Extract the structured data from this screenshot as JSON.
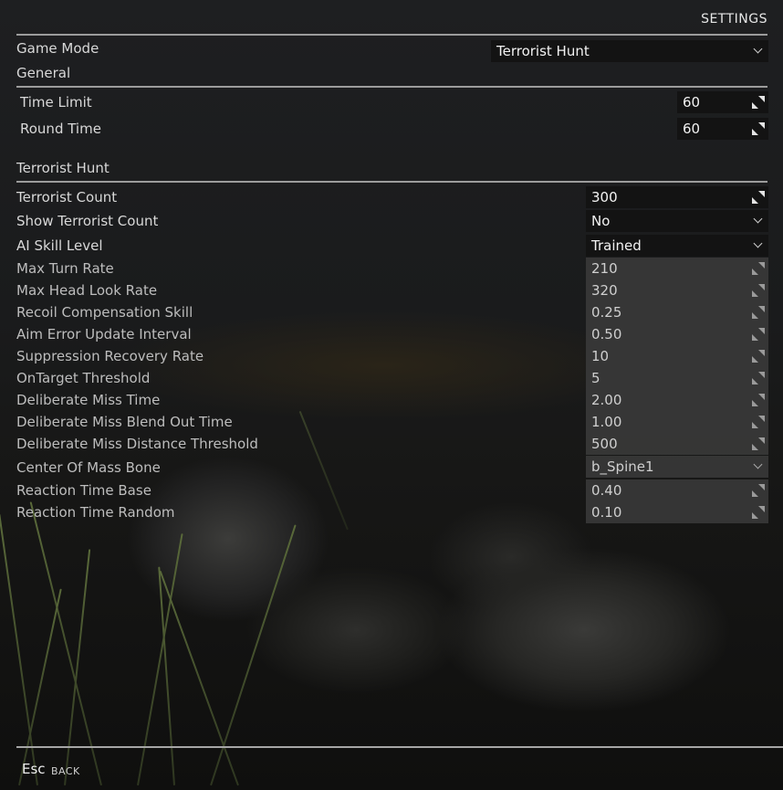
{
  "header": {
    "title": "SETTINGS"
  },
  "game_mode": {
    "label": "Game Mode",
    "value": "Terrorist Hunt"
  },
  "general": {
    "heading": "General",
    "rows": [
      {
        "label": "Time Limit",
        "value": "60"
      },
      {
        "label": "Round Time",
        "value": "60"
      }
    ]
  },
  "terrorist_hunt": {
    "heading": "Terrorist Hunt",
    "terrorist_count": {
      "label": "Terrorist Count",
      "value": "300"
    },
    "show_terrorist_count": {
      "label": "Show Terrorist Count",
      "value": "No"
    },
    "ai_skill_level": {
      "label": "AI Skill Level",
      "value": "Trained"
    },
    "advanced": [
      {
        "label": "Max Turn Rate",
        "value": "210"
      },
      {
        "label": "Max Head Look Rate",
        "value": "320"
      },
      {
        "label": "Recoil Compensation Skill",
        "value": "0.25"
      },
      {
        "label": "Aim Error Update Interval",
        "value": "0.50"
      },
      {
        "label": "Suppression Recovery Rate",
        "value": "10"
      },
      {
        "label": "OnTarget Threshold",
        "value": "5"
      },
      {
        "label": "Deliberate Miss Time",
        "value": "2.00"
      },
      {
        "label": "Deliberate Miss Blend Out Time",
        "value": "1.00"
      },
      {
        "label": "Deliberate Miss Distance Threshold",
        "value": "500"
      }
    ],
    "center_of_mass_bone": {
      "label": "Center Of Mass Bone",
      "value": "b_Spine1"
    },
    "reaction": [
      {
        "label": "Reaction Time Base",
        "value": "0.40"
      },
      {
        "label": "Reaction Time Random",
        "value": "0.10"
      }
    ]
  },
  "footer": {
    "key": "Esc",
    "action": "BACK"
  },
  "icons": {
    "dropdown": "chevron-down-icon",
    "stepper": "resize-arrows-icon"
  }
}
